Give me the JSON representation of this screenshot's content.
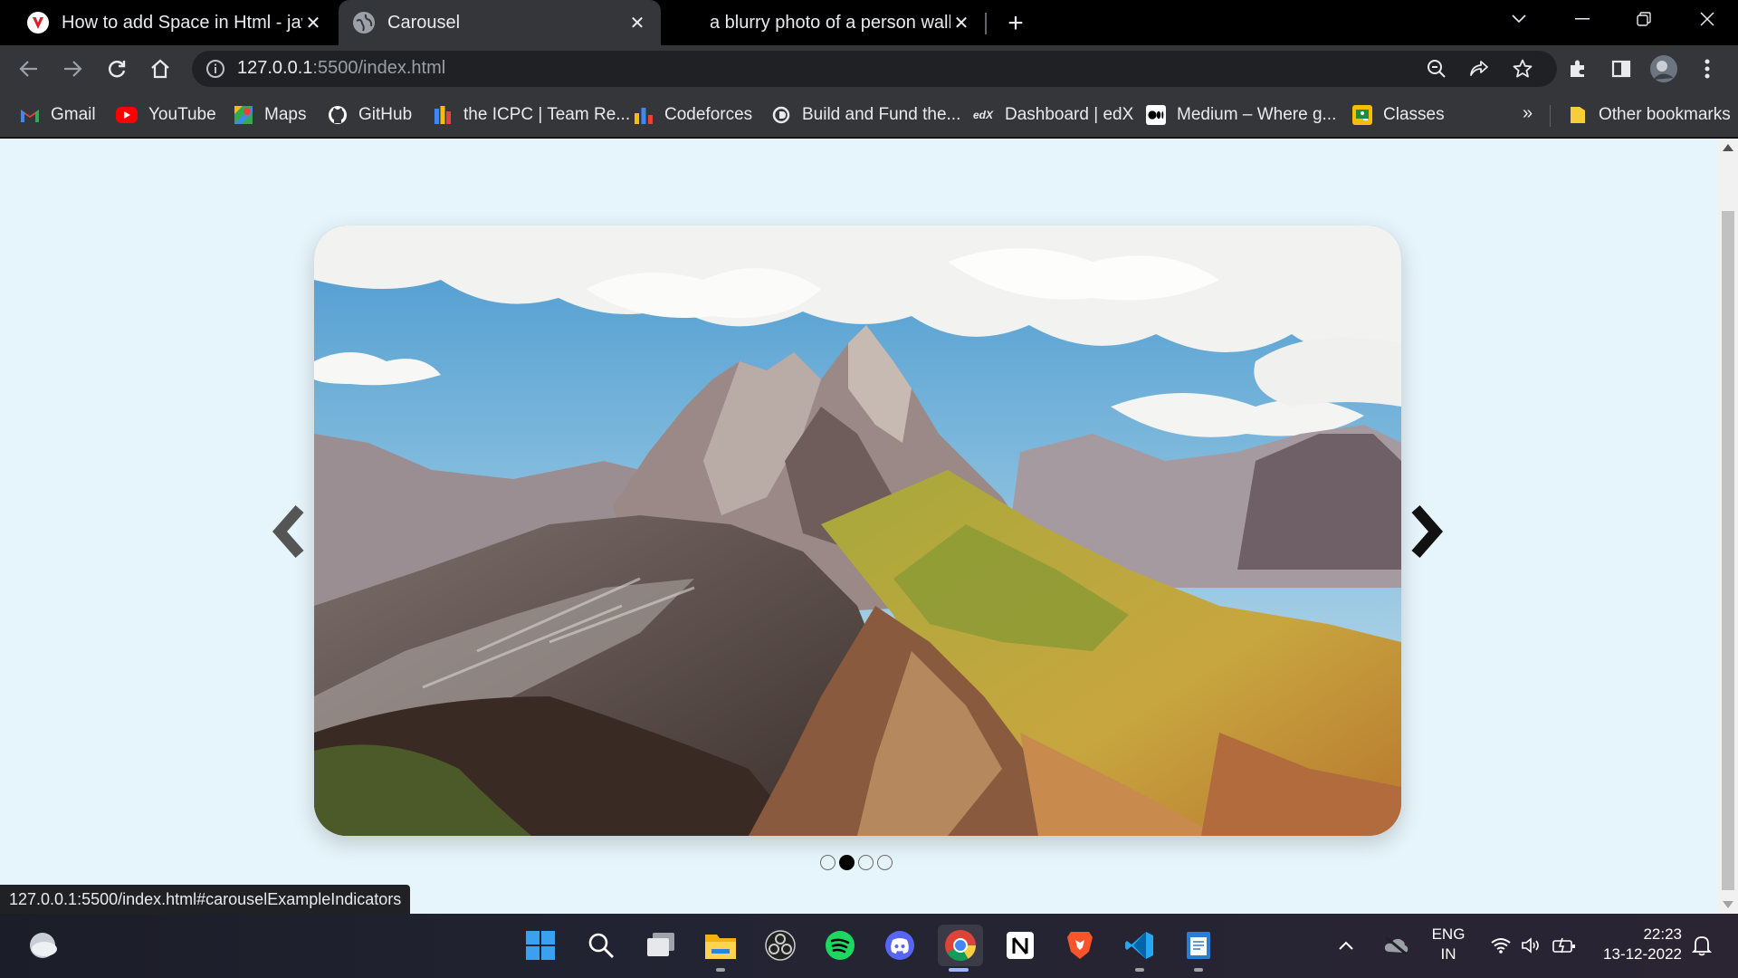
{
  "tabs": [
    {
      "title": "How to add Space in Html - javat",
      "icon": "vivaldi-red-icon",
      "active": false
    },
    {
      "title": "Carousel",
      "icon": "globe-icon",
      "active": true
    },
    {
      "title": "a blurry photo of a person walkin",
      "icon": "none",
      "active": false
    }
  ],
  "toolbar": {
    "url_host": "127.0.0.1",
    "url_path": ":5500/index.html"
  },
  "bookmarks": [
    {
      "label": "Gmail",
      "icon": "gmail-icon"
    },
    {
      "label": "YouTube",
      "icon": "youtube-icon"
    },
    {
      "label": "Maps",
      "icon": "maps-icon"
    },
    {
      "label": "GitHub",
      "icon": "github-icon"
    },
    {
      "label": "the ICPC | Team Re...",
      "icon": "icpc-icon"
    },
    {
      "label": "Codeforces",
      "icon": "codeforces-icon"
    },
    {
      "label": "Build and Fund the...",
      "icon": "devfolio-icon"
    },
    {
      "label": "Dashboard | edX",
      "icon": "edx-icon"
    },
    {
      "label": "Medium – Where g...",
      "icon": "medium-icon"
    },
    {
      "label": "Classes",
      "icon": "classroom-icon"
    }
  ],
  "bookmarks_more": "»",
  "other_bookmarks": "Other bookmarks",
  "carousel": {
    "slide_count": 4,
    "active_index": 1,
    "image": "mountain-landscape"
  },
  "status_url": "127.0.0.1:5500/index.html#carouselExampleIndicators",
  "taskbar": {
    "apps": [
      "windows-start-icon",
      "search-icon",
      "task-view-icon",
      "file-explorer-icon",
      "obs-icon",
      "spotify-icon",
      "discord-icon",
      "chrome-icon",
      "notion-icon",
      "brave-icon",
      "vscode-icon",
      "notepad-icon"
    ],
    "lang_top": "ENG",
    "lang_bottom": "IN",
    "time": "22:23",
    "date": "13-12-2022"
  }
}
